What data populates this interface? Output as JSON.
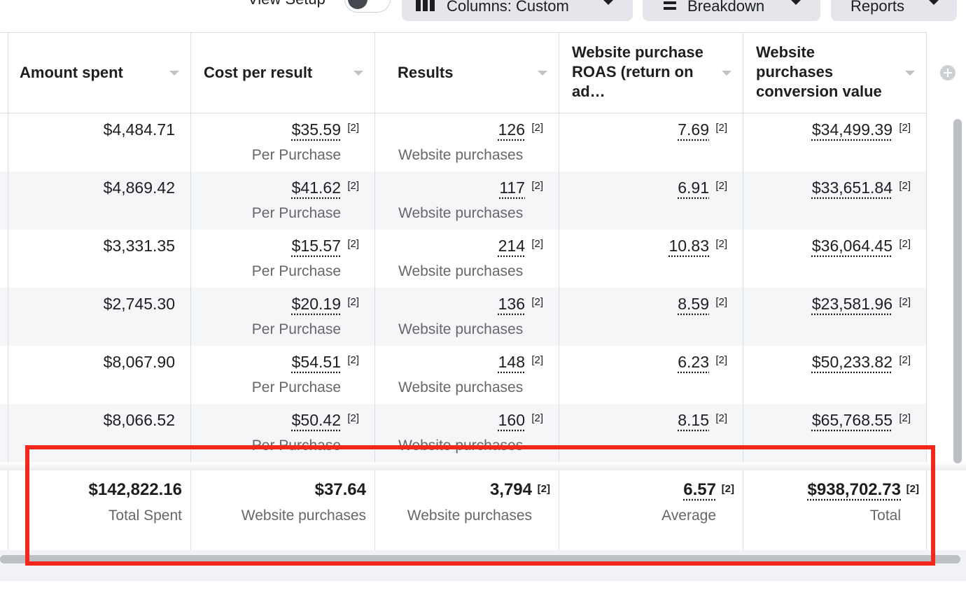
{
  "toolbar": {
    "view_setup_label": "View Setup",
    "columns_label": "Columns: Custom",
    "breakdown_label": "Breakdown",
    "reports_label": "Reports"
  },
  "columns": [
    {
      "label": "Amount spent"
    },
    {
      "label": "Cost per result"
    },
    {
      "label": "Results"
    },
    {
      "label": "Website purchase ROAS (return on ad…"
    },
    {
      "label": "Website purchases conversion value"
    }
  ],
  "ref_tag": "[2]",
  "rows": [
    {
      "amount": "$4,484.71",
      "cpr": "$35.59",
      "cpr_sub": "Per Purchase",
      "results": "126",
      "results_sub": "Website purchases",
      "roas": "7.69",
      "value": "$34,499.39"
    },
    {
      "amount": "$4,869.42",
      "cpr": "$41.62",
      "cpr_sub": "Per Purchase",
      "results": "117",
      "results_sub": "Website purchases",
      "roas": "6.91",
      "value": "$33,651.84"
    },
    {
      "amount": "$3,331.35",
      "cpr": "$15.57",
      "cpr_sub": "Per Purchase",
      "results": "214",
      "results_sub": "Website purchases",
      "roas": "10.83",
      "value": "$36,064.45"
    },
    {
      "amount": "$2,745.30",
      "cpr": "$20.19",
      "cpr_sub": "Per Purchase",
      "results": "136",
      "results_sub": "Website purchases",
      "roas": "8.59",
      "value": "$23,581.96"
    },
    {
      "amount": "$8,067.90",
      "cpr": "$54.51",
      "cpr_sub": "Per Purchase",
      "results": "148",
      "results_sub": "Website purchases",
      "roas": "6.23",
      "value": "$50,233.82"
    },
    {
      "amount": "$8,066.52",
      "cpr": "$50.42",
      "cpr_sub": "Per Purchase",
      "results": "160",
      "results_sub": "Website purchases",
      "roas": "8.15",
      "value": "$65,768.55"
    }
  ],
  "totals": {
    "amount": "$142,822.16",
    "amount_sub": "Total Spent",
    "cpr": "$37.64",
    "cpr_sub": "Website purchases",
    "results": "3,794",
    "results_sub": "Website purchases",
    "roas": "6.57",
    "roas_sub": "Average",
    "value": "$938,702.73",
    "value_sub": "Total"
  },
  "colors": {
    "highlight": "#f2281c",
    "row_alt": "#f5f6f7",
    "toolbar_button": "#e4e6eb"
  }
}
